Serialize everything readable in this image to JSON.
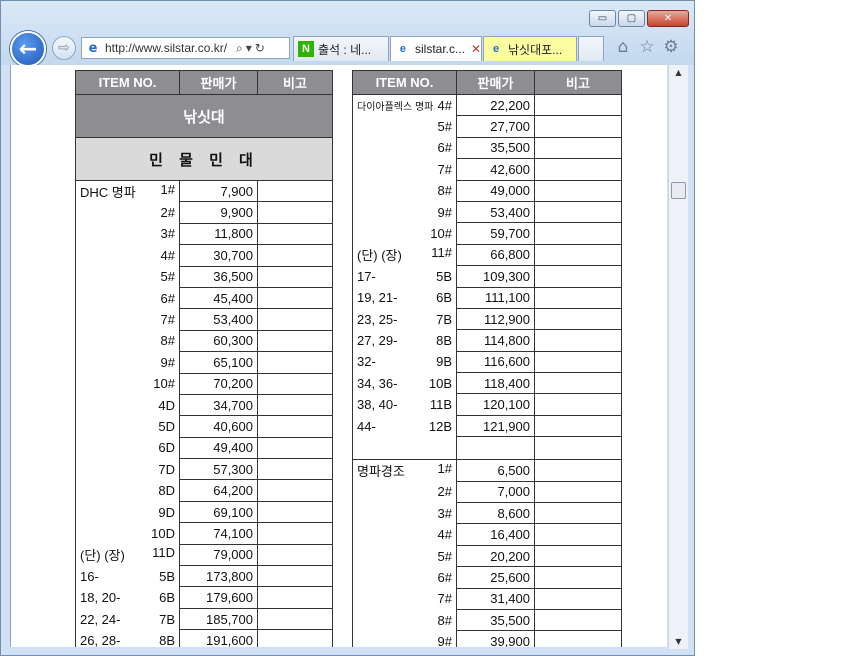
{
  "browser": {
    "address": {
      "url": "http://www.silstar.co.kr/"
    },
    "tabs": [
      {
        "title": "출석 : 네...",
        "icon": "N",
        "state": "inactive",
        "icon_color": "#2db400"
      },
      {
        "title": "silstar.c...",
        "icon": "e",
        "state": "active"
      },
      {
        "title": "낚싯대포...",
        "icon": "e",
        "state": "inactive"
      }
    ],
    "caption_buttons": {
      "minimize": "▭",
      "maximize": "▢",
      "close": "✕"
    },
    "icons": {
      "back": "←",
      "forward": "⇨",
      "search": "⌕",
      "dropdown": "▾",
      "refresh": "↻",
      "tab_close": "✕",
      "home": "⌂",
      "favorites": "☆",
      "tools": "⚙"
    }
  },
  "left_table": {
    "headers": [
      "ITEM NO.",
      "판매가",
      "비고"
    ],
    "section_title": "낚싯대",
    "subsection_title": "민 물 민 대",
    "rows": [
      {
        "label": "DHC 명파",
        "code": "1#",
        "price": "7,900"
      },
      {
        "label": "",
        "code": "2#",
        "price": "9,900"
      },
      {
        "label": "",
        "code": "3#",
        "price": "11,800"
      },
      {
        "label": "",
        "code": "4#",
        "price": "30,700"
      },
      {
        "label": "",
        "code": "5#",
        "price": "36,500"
      },
      {
        "label": "",
        "code": "6#",
        "price": "45,400"
      },
      {
        "label": "",
        "code": "7#",
        "price": "53,400"
      },
      {
        "label": "",
        "code": "8#",
        "price": "60,300"
      },
      {
        "label": "",
        "code": "9#",
        "price": "65,100"
      },
      {
        "label": "",
        "code": "10#",
        "price": "70,200"
      },
      {
        "label": "",
        "code": "4D",
        "price": "34,700"
      },
      {
        "label": "",
        "code": "5D",
        "price": "40,600"
      },
      {
        "label": "",
        "code": "6D",
        "price": "49,400"
      },
      {
        "label": "",
        "code": "7D",
        "price": "57,300"
      },
      {
        "label": "",
        "code": "8D",
        "price": "64,200"
      },
      {
        "label": "",
        "code": "9D",
        "price": "69,100"
      },
      {
        "label": "",
        "code": "10D",
        "price": "74,100"
      },
      {
        "label": "(단) (장)",
        "code": "11D",
        "price": "79,000"
      },
      {
        "label": "16-",
        "code": "5B",
        "price": "173,800"
      },
      {
        "label": "18, 20-",
        "code": "6B",
        "price": "179,600"
      },
      {
        "label": "22, 24-",
        "code": "7B",
        "price": "185,700"
      },
      {
        "label": "26, 28-",
        "code": "8B",
        "price": "191,600"
      }
    ]
  },
  "right_table": {
    "headers": [
      "ITEM NO.",
      "판매가",
      "비고"
    ],
    "rows": [
      {
        "label": "다이아플렉스 명파",
        "code": "4#",
        "price": "22,200",
        "small": true
      },
      {
        "label": "",
        "code": "5#",
        "price": "27,700"
      },
      {
        "label": "",
        "code": "6#",
        "price": "35,500"
      },
      {
        "label": "",
        "code": "7#",
        "price": "42,600"
      },
      {
        "label": "",
        "code": "8#",
        "price": "49,000"
      },
      {
        "label": "",
        "code": "9#",
        "price": "53,400"
      },
      {
        "label": "",
        "code": "10#",
        "price": "59,700"
      },
      {
        "label": "(단) (장)",
        "code": "11#",
        "price": "66,800"
      },
      {
        "label": "17-",
        "code": "5B",
        "price": "109,300"
      },
      {
        "label": "19, 21-",
        "code": "6B",
        "price": "111,100"
      },
      {
        "label": "23, 25-",
        "code": "7B",
        "price": "112,900"
      },
      {
        "label": "27, 29-",
        "code": "8B",
        "price": "114,800"
      },
      {
        "label": "32-",
        "code": "9B",
        "price": "116,600"
      },
      {
        "label": "34, 36-",
        "code": "10B",
        "price": "118,400"
      },
      {
        "label": "38, 40-",
        "code": "11B",
        "price": "120,100"
      },
      {
        "label": "44-",
        "code": "12B",
        "price": "121,900"
      },
      {
        "label": "",
        "code": "",
        "price": "",
        "gap": true
      },
      {
        "label": "명파경조",
        "code": "1#",
        "price": "6,500",
        "group_start": true
      },
      {
        "label": "",
        "code": "2#",
        "price": "7,000"
      },
      {
        "label": "",
        "code": "3#",
        "price": "8,600"
      },
      {
        "label": "",
        "code": "4#",
        "price": "16,400"
      },
      {
        "label": "",
        "code": "5#",
        "price": "20,200"
      },
      {
        "label": "",
        "code": "6#",
        "price": "25,600"
      },
      {
        "label": "",
        "code": "7#",
        "price": "31,400"
      },
      {
        "label": "",
        "code": "8#",
        "price": "35,500"
      },
      {
        "label": "",
        "code": "9#",
        "price": "39,900"
      }
    ]
  }
}
